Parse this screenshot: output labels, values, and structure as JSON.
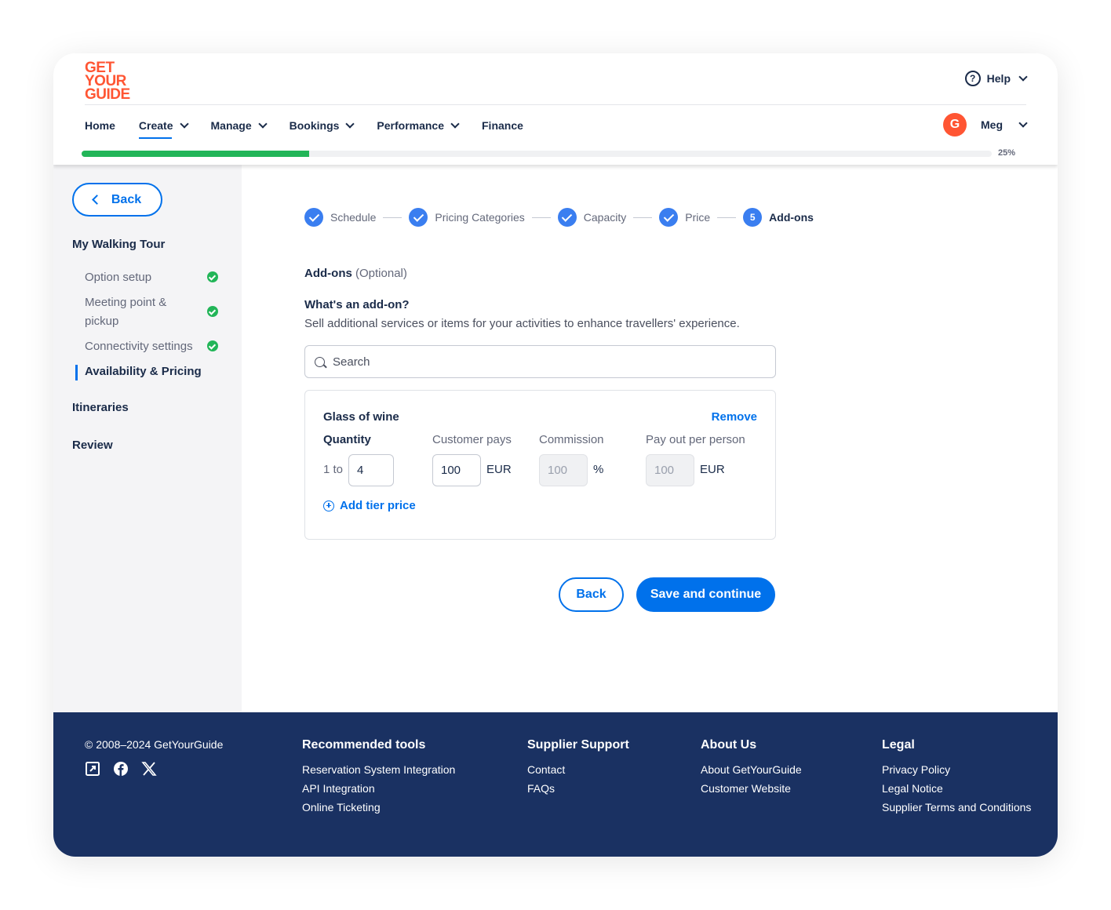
{
  "brand": {
    "logo_lines": [
      "GET",
      "YOUR",
      "GUIDE"
    ],
    "accent": "#ff5533",
    "primary": "#0071eb",
    "success": "#22b558",
    "footer_bg": "#1a3162"
  },
  "header": {
    "help_label": "Help",
    "nav": [
      "Home",
      "Create",
      "Manage",
      "Bookings",
      "Performance",
      "Finance"
    ],
    "user_initial": "G",
    "user_name": "Meg",
    "progress_percent": 25,
    "progress_label": "25%"
  },
  "sidebar": {
    "back_label": "Back",
    "tour_title": "My Walking Tour",
    "items": [
      "Option setup",
      "Meeting point & pickup",
      "Connectivity settings",
      "Availability & Pricing"
    ],
    "itineraries": "Itineraries",
    "review": "Review"
  },
  "steps": [
    {
      "label": "Schedule",
      "state": "done"
    },
    {
      "label": "Pricing Categories",
      "state": "done"
    },
    {
      "label": "Capacity",
      "state": "done"
    },
    {
      "label": "Price",
      "state": "done"
    },
    {
      "label": "Add-ons",
      "state": "current",
      "number": "5"
    }
  ],
  "main": {
    "section_title": "Add-ons",
    "section_optional": "(Optional)",
    "what_title": "What's an add-on?",
    "what_desc": "Sell additional services or items for your activities to enhance travellers' experience.",
    "search_placeholder": "Search",
    "addon": {
      "name": "Glass of wine",
      "remove": "Remove",
      "quantity_label": "Quantity",
      "customer_pays_label": "Customer pays",
      "commission_label": "Commission",
      "payout_label": "Pay out per person",
      "qty_prefix": "1 to",
      "qty_value": "4",
      "customer_pays_value": "100",
      "currency": "EUR",
      "commission_value": "100",
      "commission_unit": "%",
      "payout_value": "100",
      "payout_currency": "EUR",
      "add_tier": "Add tier price"
    },
    "back_button": "Back",
    "save_button": "Save and continue"
  },
  "footer": {
    "copyright": "© 2008–2024 GetYourGuide",
    "social_icons": [
      "external-link-icon",
      "facebook-icon",
      "x-icon"
    ],
    "columns": [
      {
        "title": "Recommended tools",
        "links": [
          "Reservation System Integration",
          "API Integration",
          "Online Ticketing"
        ]
      },
      {
        "title": "Supplier Support",
        "links": [
          "Contact",
          "FAQs"
        ]
      },
      {
        "title": "About Us",
        "links": [
          "About GetYourGuide",
          "Customer Website"
        ]
      },
      {
        "title": "Legal",
        "links": [
          "Privacy Policy",
          "Legal Notice",
          "Supplier Terms and Conditions"
        ]
      }
    ]
  }
}
